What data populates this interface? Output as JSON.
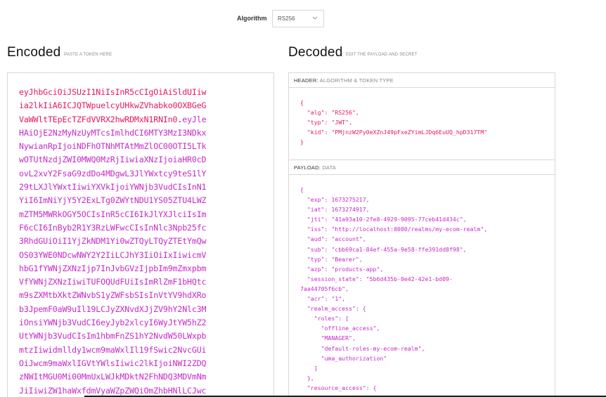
{
  "algorithm": {
    "label": "Algorithm",
    "selected": "RS256"
  },
  "encoded": {
    "title": "Encoded",
    "subtitle": "PASTE A TOKEN HERE",
    "lines": [
      [
        {
          "t": "eyJhbGciOiJSUzI1NiIsInR5cCIgOiAiSldUIiw",
          "c": "h"
        }
      ],
      [
        {
          "t": "ia2lkIiA6ICJQTWpuelcyUHkwZVhabko0OXBGeG",
          "c": "h"
        }
      ],
      [
        {
          "t": "VaWWltTEpEcTZFdVVRX2hwRDMxN1RNIn0",
          "c": "h"
        },
        {
          "t": ".",
          "c": "d"
        },
        {
          "t": "eyJle",
          "c": "p"
        }
      ],
      [
        {
          "t": "HAiOjE2NzMyNzUyMTcsImlhdCI6MTY3MzI3NDkx",
          "c": "p"
        }
      ],
      [
        {
          "t": "NywianRpIjoiNDFhOTNhMTAtMmZlOC00OTI5LTk",
          "c": "p"
        }
      ],
      [
        {
          "t": "wOTUtNzdjZWI0MWQ0MzRjIiwiaXNzIjoiaHR0cD",
          "c": "p"
        }
      ],
      [
        {
          "t": "ovL2xvY2FsaG9zdDo4MDgwL3JlYWxtcy9teS1lY",
          "c": "p"
        }
      ],
      [
        {
          "t": "29tLXJlYWxtIiwiYXVkIjoiYWNjb3VudCIsInN1",
          "c": "p"
        }
      ],
      [
        {
          "t": "YiI6ImNiYjY5Y2ExLTg0ZWYtNDU1YS05ZTU4LWZ",
          "c": "p"
        }
      ],
      [
        {
          "t": "mZTM5MWRkOGY5OCIsInR5cCI6IkJlYXJlciIsIm",
          "c": "p"
        }
      ],
      [
        {
          "t": "F6cCI6InByb2R1Y3RzLWFwcCIsInNlc3Npb25fc",
          "c": "p"
        }
      ],
      [
        {
          "t": "3RhdGUiOiI1YjZkNDM1Yi0wZTQyLTQyZTEtYmQw",
          "c": "p"
        }
      ],
      [
        {
          "t": "OS03YWE0NDcwNWY2Y2IiLCJhY3IiOiIxIiwicmV",
          "c": "p"
        }
      ],
      [
        {
          "t": "hbG1fYWNjZXNzIjp7InJvbGVzIjpbIm9mZmxpbm",
          "c": "p"
        }
      ],
      [
        {
          "t": "VfYWNjZXNzIiwiTUFOQUdFUiIsImRlZmF1bHQtc",
          "c": "p"
        }
      ],
      [
        {
          "t": "m9sZXMtbXktZWNvbS1yZWFsbSIsInVtYV9hdXRo",
          "c": "p"
        }
      ],
      [
        {
          "t": "b3JpemF0aW9uIl19LCJyZXNvdXJjZV9hY2Nlc3M",
          "c": "p"
        }
      ],
      [
        {
          "t": "iOnsiYWNjb3VudCI6eyJyb2xlcyI6WyJtYW5hZ2",
          "c": "p"
        }
      ],
      [
        {
          "t": "UtYWNjb3VudCIsIm1hbmFnZS1hY2NvdW50LWxpb",
          "c": "p"
        }
      ],
      [
        {
          "t": "mtzIiwidmlldy1wcm9maWxlIl19fSwic2NvcGUi",
          "c": "p"
        }
      ],
      [
        {
          "t": "OiJwcm9maWxlIGVtYWlsIiwic2lkIjoiNWI2ZDQ",
          "c": "p"
        }
      ],
      [
        {
          "t": "zNWItMGU0Mi00MmUxLWJkMDktN2FhNDQ3MDVmNm",
          "c": "p"
        }
      ],
      [
        {
          "t": "JiIiwiZW1haWxfdmVyaWZpZWQiOmZhbHNlLCJwc",
          "c": "p"
        }
      ]
    ]
  },
  "decoded": {
    "title": "Decoded",
    "subtitle": "EDIT THE PAYLOAD AND SECRET",
    "header_label": "HEADER:",
    "header_desc": "ALGORITHM & TOKEN TYPE",
    "header_lines": [
      "{",
      "  \"alg\": \"RS256\",",
      "  \"typ\": \"JWT\",",
      "  \"kid\": \"PMjnzW2Py0eXZnJ49pFxeZYimLJDq6EuUQ_hpD317TM\"",
      "}"
    ],
    "payload_label": "PAYLOAD:",
    "payload_desc": "DATA",
    "payload_lines": [
      "{",
      "  \"exp\": 1673275217,",
      "  \"iat\": 1673274917,",
      "  \"jti\": \"41a93a10-2fe8-4929-9095-77ceb41d434c\",",
      "  \"iss\": \"http://localhost:8080/realms/my-ecom-realm\",",
      "  \"aud\": \"account\",",
      "  \"sub\": \"cbb69ca1-84ef-455a-9e58-ffe391dd8f98\",",
      "  \"typ\": \"Bearer\",",
      "  \"azp\": \"products-app\",",
      "  \"session_state\": \"5b6d435b-0e42-42e1-bd09-",
      "7aa44705f6cb\",",
      "  \"acr\": \"1\",",
      "  \"realm_access\": {",
      "    \"roles\": [",
      "      \"offline_access\",",
      "      \"MANAGER\",",
      "      \"default-roles-my-ecom-realm\",",
      "      \"uma_authorization\"",
      "    ]",
      "  },",
      "  \"resource_access\": {"
    ]
  }
}
